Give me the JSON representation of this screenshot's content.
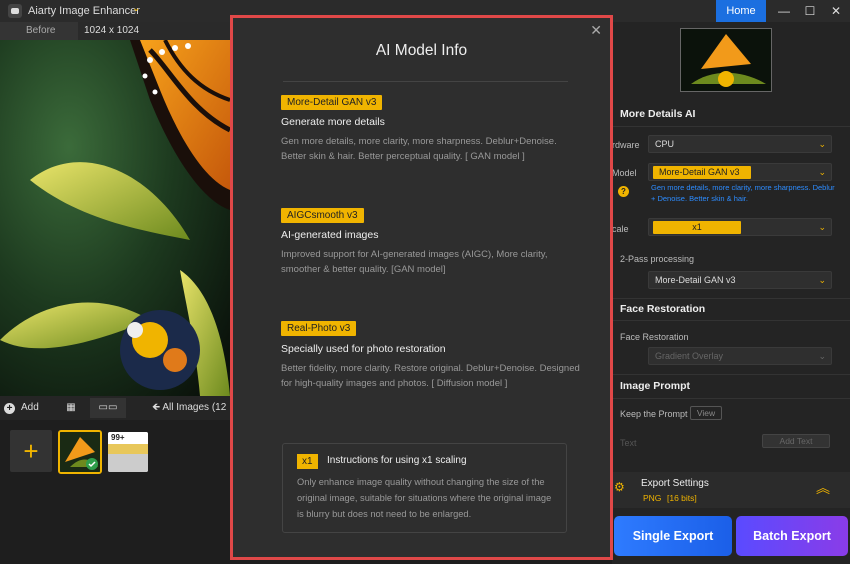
{
  "window": {
    "title": "Aiarty Image Enhancer",
    "home_label": "Home"
  },
  "tabs": {
    "before": "Before",
    "size": "1024 x 1024"
  },
  "bottom": {
    "add_label": "Add",
    "all_images": "All Images (12"
  },
  "thumbs": {
    "badge": "99+"
  },
  "right": {
    "more_details": "More Details AI",
    "hardware_label": "rdware",
    "hardware_value": "CPU",
    "model_label": "Model",
    "model_value": "More-Detail GAN  v3",
    "model_note": "Gen more details, more clarity, more sharpness. Deblur + Denoise. Better skin & hair.",
    "scale_label": "cale",
    "scale_value": "x1",
    "twopass_label": "2-Pass processing",
    "twopass_value": "More-Detail GAN  v3",
    "face_restoration_title": "Face Restoration",
    "face_restoration_label": "Face Restoration",
    "face_restoration_value": "Gradient Overlay",
    "image_prompt_title": "Image Prompt",
    "keep_prompt": "Keep the Prompt",
    "view_btn": "View",
    "text_label": "Text",
    "add_text_btn": "Add Text",
    "export_settings": "Export Settings",
    "export_format": "PNG",
    "export_bits": "[16 bits]",
    "single_export": "Single Export",
    "batch_export": "Batch Export"
  },
  "modal": {
    "title": "AI Model Info",
    "models": [
      {
        "chip": "More-Detail GAN v3",
        "heading": "Generate more details",
        "desc": "Gen more details, more clarity, more sharpness. Deblur+Denoise. Better skin & hair. Better perceptual quality.  [ GAN model ]"
      },
      {
        "chip": "AIGCsmooth v3",
        "heading": "AI-generated images",
        "desc": "Improved support for AI-generated images (AIGC), More clarity, smoother & better quality. [GAN model]"
      },
      {
        "chip": "Real-Photo v3",
        "heading": "Specially used for photo restoration",
        "desc": "Better fidelity, more clarity. Restore original. Deblur+Denoise. Designed for high-quality images and photos.  [ Diffusion model ]"
      }
    ],
    "x1_chip": "x1",
    "x1_title": "Instructions for using x1 scaling",
    "x1_desc": "Only enhance image quality without changing the size of the original image, suitable for situations where the original image is blurry but does not need to be enlarged."
  }
}
